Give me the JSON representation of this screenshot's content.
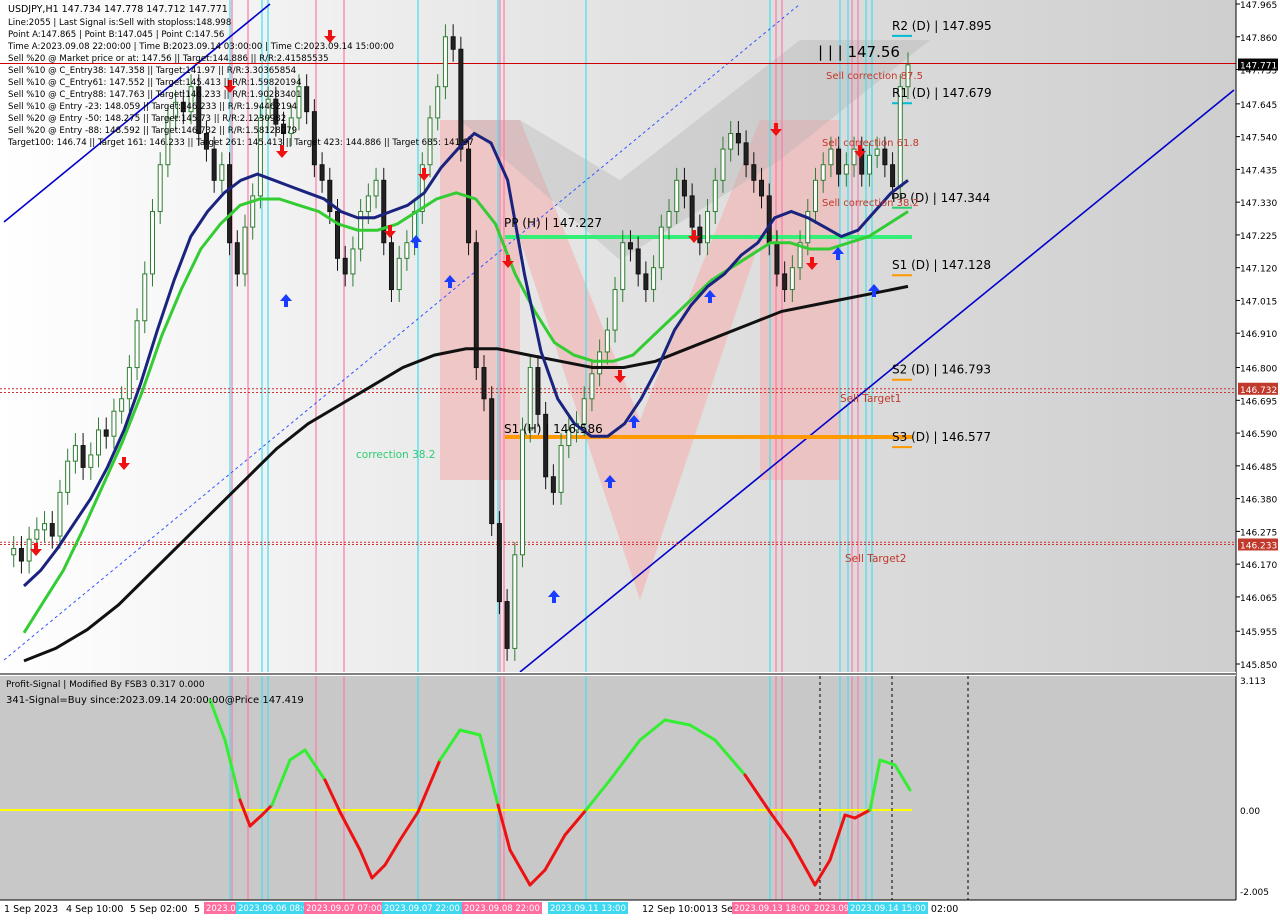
{
  "symbol_header": "USDJPY,H1  147.734 147.778 147.712 147.771",
  "info_lines": [
    "Line:2055 | Last Signal is:Sell with stoploss:148.998",
    "Point A:147.865 | Point B:147.045 | Point C:147.56",
    "Time A:2023.09.08 22:00:00 | Time B:2023.09.14 03:00:00 | Time C:2023.09.14 15:00:00",
    "Sell %20 @ Market price or at: 147.56 || Target:144.886 || R/R:2.41585535",
    "Sell %10 @ C_Entry38: 147.358 || Target:141.97 || R/R:3.30365854",
    "Sell %10 @ C_Entry61: 147.552 || Target:145.413 || R/R:1.59820194",
    "Sell %10 @ C_Entry88: 147.763 || Target:146.233 || R/R:1.90283401",
    "Sell %10 @ Entry -23: 148.059 || Target:146.233 || R/R:1.94462194",
    "Sell %20 @ Entry -50: 148.275 || Target:145.73 || R/R:2.1230982",
    "Sell %20 @ Entry -88: 148.592 || Target:146.732 || R/R:1.58128079",
    "Target100: 146.74 || Target 161: 146.233 || Target 261: 145.413 || Target 423: 144.886 || Target 685: 141.97"
  ],
  "price_axis": [
    "147.965",
    "147.860",
    "147.755",
    "147.645",
    "147.540",
    "147.435",
    "147.330",
    "147.225",
    "147.120",
    "147.015",
    "146.910",
    "146.800",
    "146.695",
    "146.590",
    "146.485",
    "146.380",
    "146.275",
    "146.170",
    "146.065",
    "145.955",
    "145.850"
  ],
  "price_tags": [
    {
      "label": "147.771",
      "color": "#000000",
      "price": 147.771
    },
    {
      "label": "146.732",
      "color": "#c0392b",
      "price": 146.732
    },
    {
      "label": "146.233",
      "color": "#c0392b",
      "price": 146.233
    }
  ],
  "pivot_labels": [
    {
      "text": "R2 (D) | 147.895",
      "color": "#00bcd4",
      "price": 147.895
    },
    {
      "text": "R1 (D) | 147.679",
      "color": "#00bcd4",
      "price": 147.679
    },
    {
      "text": "PP (D) | 147.344",
      "color": "#2ecc71",
      "price": 147.344
    },
    {
      "text": "S1 (D) | 147.128",
      "color": "#ff9800",
      "price": 147.128
    },
    {
      "text": "S2 (D) | 146.793",
      "color": "#ff9800",
      "price": 146.793
    },
    {
      "text": "S3 (D) | 146.577",
      "color": "#ff9800",
      "price": 146.577
    }
  ],
  "chart_labels": [
    {
      "text": "| | | 147.56",
      "color": "#000000"
    },
    {
      "text": "Sell correction 87.5",
      "color": "#c0392b"
    },
    {
      "text": "Sell correction 61.8",
      "color": "#c0392b"
    },
    {
      "text": "Sell correction 38.2",
      "color": "#c0392b"
    },
    {
      "text": "PP (H) | 147.227",
      "color": "#000000"
    },
    {
      "text": "S1 (H) | 146.586",
      "color": "#000000"
    },
    {
      "text": "correction 38.2",
      "color": "#2ecc71"
    },
    {
      "text": "Sell Target1",
      "color": "#c0392b"
    },
    {
      "text": "Sell Target2",
      "color": "#c0392b"
    }
  ],
  "indicator": {
    "title": "Profit-Signal | Modified By FSB3 0.317 0.000",
    "signal_text": "341-Signal=Buy since:2023.09.14 20:00:00@Price 147.419",
    "axis": [
      "3.113",
      "0.00",
      "-2.005"
    ]
  },
  "time_axis": [
    "1 Sep 2023",
    "4 Sep 10:00",
    "5 Sep 02:00",
    "5",
    "12 Sep 10:00",
    "13 Se",
    "Sep 02:00"
  ],
  "time_tags": [
    "2023.09.05 13:00",
    "2023.09.06 08:00",
    "2023.09.07 07:00",
    "2023.09.07 22:00",
    "2023.09.08 22:00",
    "2023.09.11 13:00",
    "2023.09.13 18:00",
    "2023.09.14 03:00",
    "2023.09.14 15:00"
  ],
  "colors": {
    "bull": "#2e7d32",
    "bear": "#111111",
    "ema_fast": "#1a237e",
    "ema_mid": "#33cc33",
    "ema_slow": "#111111",
    "channel": "#0000cc",
    "pp": "#33ee77",
    "s_level": "#ff9900"
  },
  "chart_data": {
    "type": "line",
    "title": "USDJPY,H1",
    "ylim": [
      145.85,
      147.965
    ],
    "series": [
      {
        "values": [
          146.2,
          146.22,
          146.18,
          146.25,
          146.28,
          146.3,
          146.26,
          146.4,
          146.5,
          146.55,
          146.48,
          146.52,
          146.6,
          146.58,
          146.66,
          146.7,
          146.8,
          146.95,
          147.1,
          147.3,
          147.45,
          147.6,
          147.65,
          147.62,
          147.7,
          147.55,
          147.5,
          147.4,
          147.45,
          147.2,
          147.1,
          147.25,
          147.35,
          147.6,
          147.66,
          147.58,
          147.55,
          147.6,
          147.7,
          147.62,
          147.45,
          147.4,
          147.3,
          147.15,
          147.1,
          147.18,
          147.3,
          147.35,
          147.4,
          147.2,
          147.05,
          147.15,
          147.2,
          147.3,
          147.45,
          147.6,
          147.7,
          147.86,
          147.82,
          147.5,
          147.2,
          146.8,
          146.7,
          146.3,
          146.05,
          145.9,
          146.2,
          146.6,
          146.8,
          146.65,
          146.45,
          146.4,
          146.55,
          146.6,
          146.62,
          146.7,
          146.78,
          146.85,
          146.92,
          147.05,
          147.2,
          147.18,
          147.1,
          147.05,
          147.12,
          147.25,
          147.3,
          147.4,
          147.35,
          147.25,
          147.2,
          147.3,
          147.4,
          147.5,
          147.55,
          147.52,
          147.45,
          147.4,
          147.35,
          147.2,
          147.1,
          147.05,
          147.12,
          147.2,
          147.3,
          147.4,
          147.45,
          147.5,
          147.42,
          147.45,
          147.5,
          147.42,
          147.48,
          147.5,
          147.45,
          147.38,
          147.7,
          147.77
        ]
      },
      {
        "values": [
          146.1,
          146.15,
          146.22,
          146.3,
          146.38,
          146.48,
          146.6,
          146.75,
          146.92,
          147.08,
          147.22,
          147.3,
          147.36,
          147.4,
          147.42,
          147.4,
          147.38,
          147.36,
          147.34,
          147.3,
          147.28,
          147.28,
          147.3,
          147.32,
          147.36,
          147.44,
          147.5,
          147.55,
          147.52,
          147.4,
          147.1,
          146.85,
          146.7,
          146.62,
          146.58,
          146.58,
          146.62,
          146.7,
          146.8,
          146.92,
          147.0,
          147.06,
          147.1,
          147.16,
          147.2,
          147.28,
          147.3,
          147.28,
          147.25,
          147.22,
          147.24,
          147.3,
          147.36,
          147.4
        ]
      },
      {
        "values": [
          145.95,
          146.05,
          146.15,
          146.28,
          146.42,
          146.56,
          146.72,
          146.9,
          147.05,
          147.18,
          147.26,
          147.32,
          147.34,
          147.34,
          147.32,
          147.3,
          147.26,
          147.24,
          147.24,
          147.26,
          147.3,
          147.34,
          147.36,
          147.34,
          147.26,
          147.1,
          146.98,
          146.88,
          146.84,
          146.82,
          146.82,
          146.84,
          146.9,
          146.96,
          147.02,
          147.08,
          147.12,
          147.16,
          147.2,
          147.2,
          147.18,
          147.18,
          147.2,
          147.22,
          147.26,
          147.3
        ]
      },
      {
        "values": [
          145.86,
          145.9,
          145.96,
          146.04,
          146.14,
          146.24,
          146.34,
          146.44,
          146.54,
          146.62,
          146.68,
          146.74,
          146.8,
          146.84,
          146.86,
          146.86,
          146.84,
          146.82,
          146.8,
          146.8,
          146.82,
          146.86,
          146.9,
          146.94,
          146.98,
          147.0,
          147.02,
          147.04,
          147.06
        ]
      }
    ]
  }
}
